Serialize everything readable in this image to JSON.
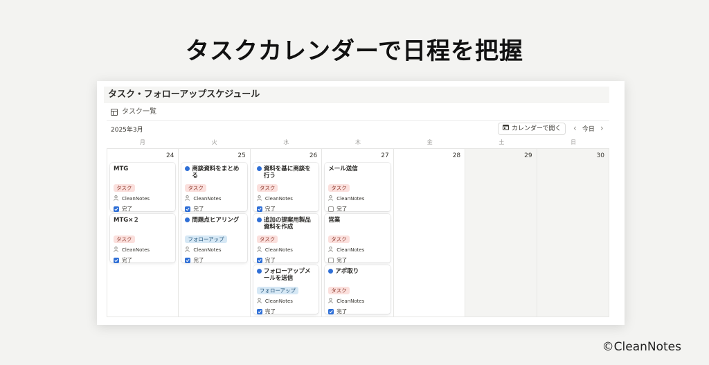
{
  "headline": "タスクカレンダーで日程を把握",
  "credit": "©CleanNotes",
  "database": {
    "title": "タスク・フォローアップスケジュール",
    "view_label": "タスク一覧",
    "view_icon": "table-icon"
  },
  "toolbar": {
    "month": "2025年3月",
    "open_calendar_label": "カレンダーで開く",
    "open_calendar_icon": "calendar-icon",
    "prev_icon": "chevron-left-icon",
    "today_label": "今日",
    "next_icon": "chevron-right-icon"
  },
  "weekdays": [
    "月",
    "火",
    "水",
    "木",
    "金",
    "土",
    "日"
  ],
  "days": [
    {
      "num": "24",
      "cards": [
        {
          "title": "MTG",
          "dot": false,
          "tag": "タスク",
          "tag_type": "task",
          "owner": "CleanNotes",
          "done_label": "完了",
          "done": true
        },
        {
          "title": "MTG×２",
          "dot": false,
          "tag": "タスク",
          "tag_type": "task",
          "owner": "CleanNotes",
          "done_label": "完了",
          "done": true
        }
      ]
    },
    {
      "num": "25",
      "cards": [
        {
          "title": "商談資料をまとめる",
          "dot": true,
          "tag": "タスク",
          "tag_type": "task",
          "owner": "CleanNotes",
          "done_label": "完了",
          "done": true
        },
        {
          "title": "問題点ヒアリング",
          "dot": true,
          "tag": "フォローアップ",
          "tag_type": "follow",
          "owner": "CleanNotes",
          "done_label": "完了",
          "done": true
        }
      ]
    },
    {
      "num": "26",
      "cards": [
        {
          "title": "資料を基に商談を行う",
          "dot": true,
          "tag": "タスク",
          "tag_type": "task",
          "owner": "CleanNotes",
          "done_label": "完了",
          "done": true
        },
        {
          "title": "追加の提案用製品資料を作成",
          "dot": true,
          "tag": "タスク",
          "tag_type": "task",
          "owner": "CleanNotes",
          "done_label": "完了",
          "done": true
        },
        {
          "title": "フォローアップメールを送信",
          "dot": true,
          "tag": "フォローアップ",
          "tag_type": "follow",
          "owner": "CleanNotes",
          "done_label": "完了",
          "done": true
        }
      ]
    },
    {
      "num": "27",
      "cards": [
        {
          "title": "メール送信",
          "dot": false,
          "tag": "タスク",
          "tag_type": "task",
          "owner": "CleanNotes",
          "done_label": "完了",
          "done": false
        },
        {
          "title": "営業",
          "dot": false,
          "tag": "タスク",
          "tag_type": "task",
          "owner": "CleanNotes",
          "done_label": "完了",
          "done": false
        },
        {
          "title": "アポ取り",
          "dot": true,
          "tag": "タスク",
          "tag_type": "task",
          "owner": "CleanNotes",
          "done_label": "完了",
          "done": true
        }
      ]
    },
    {
      "num": "28",
      "cards": []
    },
    {
      "num": "29",
      "cards": []
    },
    {
      "num": "30",
      "cards": []
    }
  ],
  "colors": {
    "accent": "#2f6fd6",
    "task_tag_bg": "#fbe0dd",
    "follow_tag_bg": "#d6e8f5",
    "weekend_bg": "#f4f4f2"
  }
}
